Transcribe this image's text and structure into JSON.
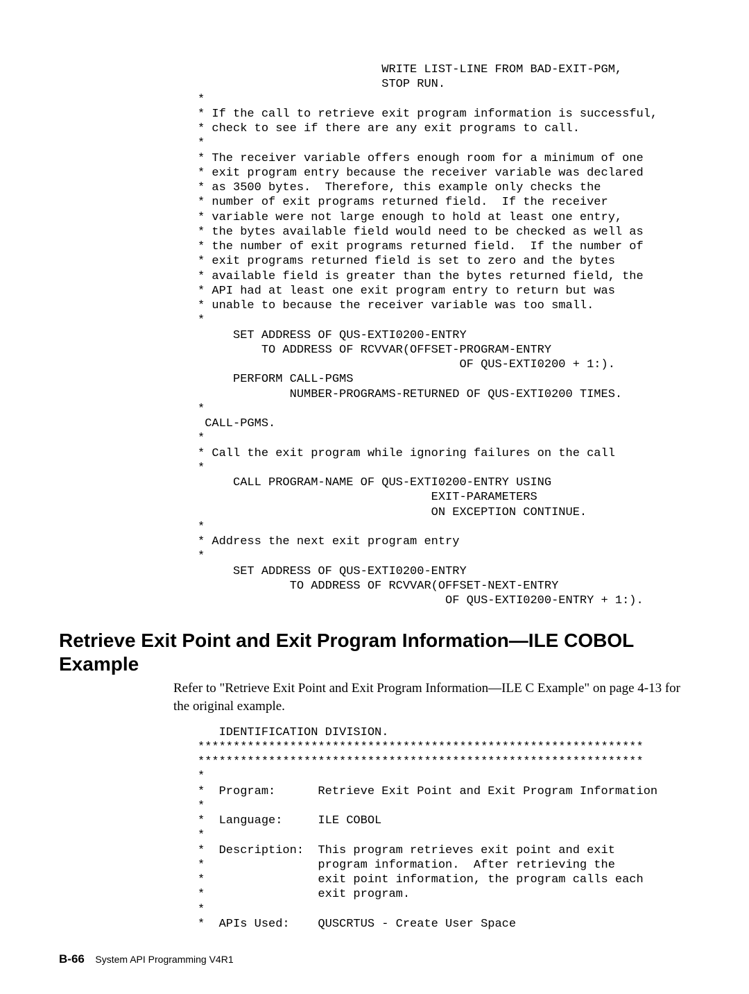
{
  "code1": "                          WRITE LIST-LINE FROM BAD-EXIT-PGM,\n                          STOP RUN.\n*\n* If the call to retrieve exit program information is successful,\n* check to see if there are any exit programs to call.\n*\n* The receiver variable offers enough room for a minimum of one\n* exit program entry because the receiver variable was declared\n* as 3500 bytes.  Therefore, this example only checks the\n* number of exit programs returned field.  If the receiver\n* variable were not large enough to hold at least one entry,\n* the bytes available field would need to be checked as well as\n* the number of exit programs returned field.  If the number of\n* exit programs returned field is set to zero and the bytes\n* available field is greater than the bytes returned field, the\n* API had at least one exit program entry to return but was\n* unable to because the receiver variable was too small.\n*\n     SET ADDRESS OF QUS-EXTI0200-ENTRY\n         TO ADDRESS OF RCVVAR(OFFSET-PROGRAM-ENTRY\n                                     OF QUS-EXTI0200 + 1:).\n     PERFORM CALL-PGMS\n             NUMBER-PROGRAMS-RETURNED OF QUS-EXTI0200 TIMES.\n*\n CALL-PGMS.\n*\n* Call the exit program while ignoring failures on the call\n*\n     CALL PROGRAM-NAME OF QUS-EXTI0200-ENTRY USING\n                                 EXIT-PARAMETERS\n                                 ON EXCEPTION CONTINUE.\n*\n* Address the next exit program entry\n*\n     SET ADDRESS OF QUS-EXTI0200-ENTRY\n             TO ADDRESS OF RCVVAR(OFFSET-NEXT-ENTRY\n                                   OF QUS-EXTI0200-ENTRY + 1:).",
  "heading": "Retrieve Exit Point and Exit Program Information—ILE COBOL Example",
  "intro": "Refer to \"Retrieve Exit Point and Exit Program Information—ILE C Example\" on page 4-13 for the original example.",
  "code2": "   IDENTIFICATION DIVISION.\n***************************************************************\n***************************************************************\n*\n*  Program:      Retrieve Exit Point and Exit Program Information\n*\n*  Language:     ILE COBOL\n*\n*  Description:  This program retrieves exit point and exit\n*                program information.  After retrieving the\n*                exit point information, the program calls each\n*                exit program.\n*\n*  APIs Used:    QUSCRTUS - Create User Space",
  "footer": {
    "pagenum": "B-66",
    "title": "System API Programming V4R1"
  }
}
